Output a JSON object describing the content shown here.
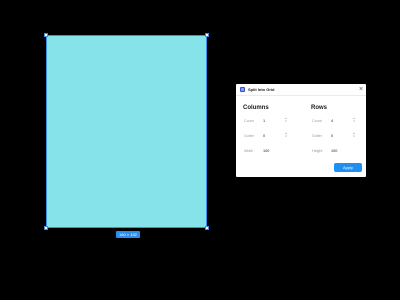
{
  "canvas": {
    "frame_color": "#86e3ea",
    "selection_color": "#3a8ee6",
    "size_badge": "160 × 192"
  },
  "dialog": {
    "title": "Split Into Grid",
    "app_icon": "plugin-app-icon",
    "close_icon": "close-icon",
    "columns": {
      "heading": "Columns",
      "count_label": "Count",
      "count_value": "1",
      "gutter_label": "Gutter",
      "gutter_value": "0",
      "width_label": "Width",
      "width_value": "100"
    },
    "rows": {
      "heading": "Rows",
      "count_label": "Count",
      "count_value": "4",
      "gutter_label": "Gutter",
      "gutter_value": "0",
      "height_label": "Height",
      "height_value": "100"
    },
    "apply_label": "Apply",
    "accent_color": "#1f8ff0"
  }
}
